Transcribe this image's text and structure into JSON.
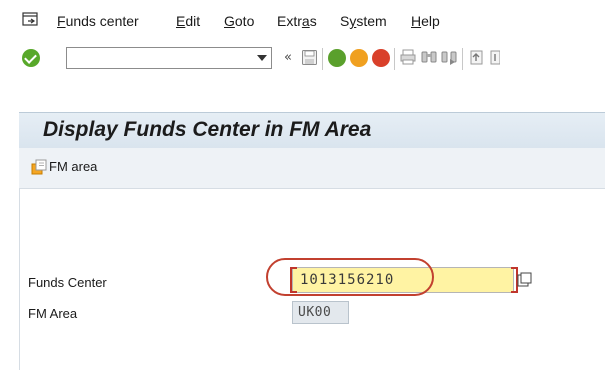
{
  "menubar": {
    "icon": "exit-menu-icon",
    "items": [
      {
        "pre": "",
        "u": "F",
        "post": "unds center"
      },
      {
        "pre": "",
        "u": "E",
        "post": "dit"
      },
      {
        "pre": "",
        "u": "G",
        "post": "oto"
      },
      {
        "pre": "Extr",
        "u": "a",
        "post": "s"
      },
      {
        "pre": "S",
        "u": "y",
        "post": "stem"
      },
      {
        "pre": "",
        "u": "H",
        "post": "elp"
      }
    ]
  },
  "toolbar": {
    "command_value": "",
    "icons": [
      "enter-icon",
      "command-field-dropdown-icon",
      "collapse-icon",
      "save-icon",
      "back-icon",
      "exit-icon",
      "cancel-icon",
      "print-icon",
      "find-icon",
      "find-next-icon",
      "first-page-icon",
      "previous-page-icon"
    ]
  },
  "colors": {
    "title_bg": "#dde6ef",
    "required_field_bg": "#fff3a3",
    "readonly_field_bg": "#e3e8ed",
    "highlight": "#c2402f",
    "ok_green": "#58a82a"
  },
  "title": "Display Funds Center in FM Area",
  "app_toolbar": {
    "fm_area_button": "FM area"
  },
  "form": {
    "funds_center_label": "Funds Center",
    "funds_center_value": "1013156210",
    "fm_area_label": "FM Area",
    "fm_area_value": "UK00"
  }
}
